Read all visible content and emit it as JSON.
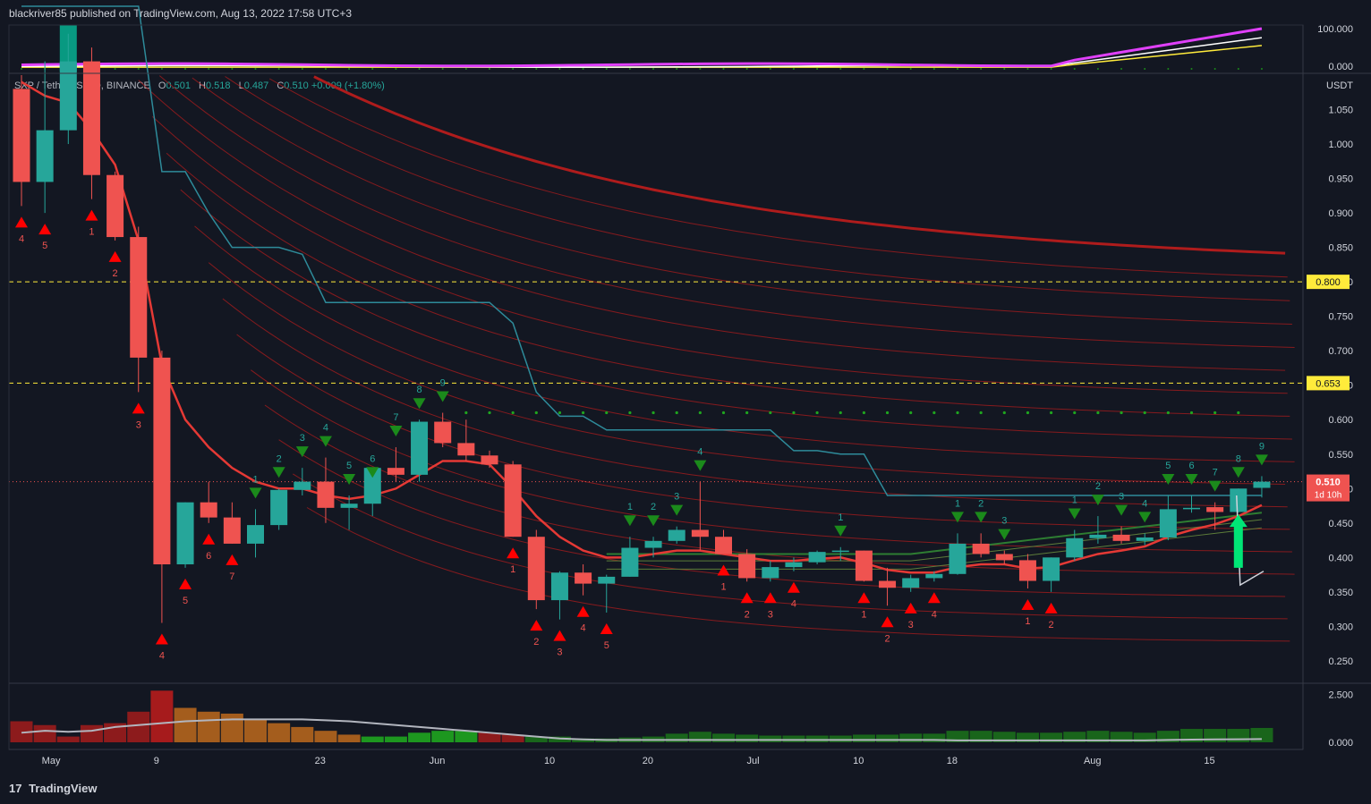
{
  "header": {
    "text": "blackriver85 published on TradingView.com, Aug 13, 2022 17:58 UTC+3"
  },
  "footer": {
    "brand": "TradingView",
    "logo_text": "17"
  },
  "symbol": {
    "name": "SXP / TetherUS, 2D, BINANCE",
    "o_label": "O",
    "o": "0.501",
    "h_label": "H",
    "h": "0.518",
    "l_label": "L",
    "l": "0.487",
    "c_label": "C",
    "c": "0.510",
    "change": "+0.009 (+1.80%)"
  },
  "price_axis": {
    "currency": "USDT",
    "ticks": [
      "1.050",
      "1.000",
      "0.950",
      "0.900",
      "0.850",
      "0.800",
      "0.750",
      "0.700",
      "0.650",
      "0.600",
      "0.550",
      "0.500",
      "0.450",
      "0.400",
      "0.350",
      "0.300",
      "0.250"
    ],
    "tick_values": [
      1.05,
      1.0,
      0.95,
      0.9,
      0.85,
      0.8,
      0.75,
      0.7,
      0.65,
      0.6,
      0.55,
      0.5,
      0.45,
      0.4,
      0.35,
      0.3,
      0.25
    ],
    "current_price_label": "0.510",
    "current_price": 0.51,
    "countdown": "1d 10h",
    "levels": [
      {
        "label": "0.800",
        "value": 0.8
      },
      {
        "label": "0.653",
        "value": 0.653
      }
    ]
  },
  "oscillator_axis": {
    "ticks": [
      "100.000",
      "0.000"
    ]
  },
  "volume_axis": {
    "ticks": [
      "2.500",
      "0.000"
    ]
  },
  "time_axis": {
    "labels": [
      "May",
      "9",
      "23",
      "Jun",
      "10",
      "20",
      "Jul",
      "10",
      "18",
      "Aug",
      "15"
    ],
    "positions": [
      2.5,
      7,
      14,
      19,
      23.8,
      28,
      32.5,
      37,
      41,
      47,
      52
    ]
  },
  "colors": {
    "bg": "#131722",
    "up": "#26a69a",
    "down": "#ef5350",
    "ema": "#e53935",
    "baseline": "#2e8b9a",
    "level": "#ffeb3b",
    "green_line": "#2e7d32",
    "signal_up": "#ff0000",
    "signal_down": "#1b8a1b"
  },
  "chart_data": {
    "type": "candlestick",
    "timeframe": "2D",
    "candles": [
      {
        "o": 1.08,
        "h": 1.1,
        "l": 0.91,
        "c": 0.945
      },
      {
        "o": 0.945,
        "h": 1.12,
        "l": 0.9,
        "c": 1.02
      },
      {
        "o": 1.02,
        "h": 1.16,
        "l": 1.0,
        "c": 1.12
      },
      {
        "o": 1.12,
        "h": 1.14,
        "l": 0.92,
        "c": 0.955
      },
      {
        "o": 0.955,
        "h": 0.96,
        "l": 0.86,
        "c": 0.865
      },
      {
        "o": 0.865,
        "h": 0.88,
        "l": 0.64,
        "c": 0.69
      },
      {
        "o": 0.69,
        "h": 0.7,
        "l": 0.305,
        "c": 0.39
      },
      {
        "o": 0.39,
        "h": 0.48,
        "l": 0.385,
        "c": 0.48
      },
      {
        "o": 0.48,
        "h": 0.51,
        "l": 0.45,
        "c": 0.458
      },
      {
        "o": 0.458,
        "h": 0.48,
        "l": 0.42,
        "c": 0.42
      },
      {
        "o": 0.42,
        "h": 0.47,
        "l": 0.4,
        "c": 0.447
      },
      {
        "o": 0.447,
        "h": 0.5,
        "l": 0.44,
        "c": 0.498
      },
      {
        "o": 0.498,
        "h": 0.53,
        "l": 0.49,
        "c": 0.51
      },
      {
        "o": 0.51,
        "h": 0.545,
        "l": 0.45,
        "c": 0.472
      },
      {
        "o": 0.472,
        "h": 0.49,
        "l": 0.44,
        "c": 0.478
      },
      {
        "o": 0.478,
        "h": 0.5,
        "l": 0.46,
        "c": 0.53
      },
      {
        "o": 0.53,
        "h": 0.56,
        "l": 0.51,
        "c": 0.52
      },
      {
        "o": 0.52,
        "h": 0.6,
        "l": 0.51,
        "c": 0.597
      },
      {
        "o": 0.597,
        "h": 0.61,
        "l": 0.56,
        "c": 0.566
      },
      {
        "o": 0.566,
        "h": 0.6,
        "l": 0.54,
        "c": 0.548
      },
      {
        "o": 0.548,
        "h": 0.555,
        "l": 0.53,
        "c": 0.535
      },
      {
        "o": 0.535,
        "h": 0.54,
        "l": 0.43,
        "c": 0.43
      },
      {
        "o": 0.43,
        "h": 0.44,
        "l": 0.325,
        "c": 0.338
      },
      {
        "o": 0.338,
        "h": 0.38,
        "l": 0.31,
        "c": 0.378
      },
      {
        "o": 0.378,
        "h": 0.39,
        "l": 0.345,
        "c": 0.362
      },
      {
        "o": 0.362,
        "h": 0.375,
        "l": 0.32,
        "c": 0.372
      },
      {
        "o": 0.372,
        "h": 0.43,
        "l": 0.372,
        "c": 0.414
      },
      {
        "o": 0.414,
        "h": 0.43,
        "l": 0.4,
        "c": 0.424
      },
      {
        "o": 0.424,
        "h": 0.445,
        "l": 0.42,
        "c": 0.44
      },
      {
        "o": 0.44,
        "h": 0.51,
        "l": 0.41,
        "c": 0.43
      },
      {
        "o": 0.43,
        "h": 0.44,
        "l": 0.405,
        "c": 0.405
      },
      {
        "o": 0.405,
        "h": 0.412,
        "l": 0.365,
        "c": 0.37
      },
      {
        "o": 0.37,
        "h": 0.395,
        "l": 0.365,
        "c": 0.386
      },
      {
        "o": 0.386,
        "h": 0.4,
        "l": 0.38,
        "c": 0.393
      },
      {
        "o": 0.393,
        "h": 0.41,
        "l": 0.39,
        "c": 0.408
      },
      {
        "o": 0.408,
        "h": 0.415,
        "l": 0.395,
        "c": 0.41
      },
      {
        "o": 0.41,
        "h": 0.41,
        "l": 0.365,
        "c": 0.366
      },
      {
        "o": 0.366,
        "h": 0.385,
        "l": 0.33,
        "c": 0.356
      },
      {
        "o": 0.356,
        "h": 0.375,
        "l": 0.35,
        "c": 0.37
      },
      {
        "o": 0.37,
        "h": 0.38,
        "l": 0.365,
        "c": 0.376
      },
      {
        "o": 0.376,
        "h": 0.435,
        "l": 0.375,
        "c": 0.42
      },
      {
        "o": 0.42,
        "h": 0.435,
        "l": 0.4,
        "c": 0.405
      },
      {
        "o": 0.405,
        "h": 0.41,
        "l": 0.39,
        "c": 0.396
      },
      {
        "o": 0.396,
        "h": 0.405,
        "l": 0.355,
        "c": 0.366
      },
      {
        "o": 0.366,
        "h": 0.4,
        "l": 0.35,
        "c": 0.4
      },
      {
        "o": 0.4,
        "h": 0.44,
        "l": 0.395,
        "c": 0.428
      },
      {
        "o": 0.428,
        "h": 0.46,
        "l": 0.42,
        "c": 0.433
      },
      {
        "o": 0.433,
        "h": 0.445,
        "l": 0.42,
        "c": 0.424
      },
      {
        "o": 0.424,
        "h": 0.435,
        "l": 0.418,
        "c": 0.429
      },
      {
        "o": 0.429,
        "h": 0.49,
        "l": 0.425,
        "c": 0.47
      },
      {
        "o": 0.47,
        "h": 0.49,
        "l": 0.465,
        "c": 0.472
      },
      {
        "o": 0.473,
        "h": 0.48,
        "l": 0.44,
        "c": 0.466
      },
      {
        "o": 0.466,
        "h": 0.5,
        "l": 0.465,
        "c": 0.5
      },
      {
        "o": 0.501,
        "h": 0.518,
        "l": 0.487,
        "c": 0.51
      }
    ],
    "ema_line": [
      1.09,
      1.07,
      1.06,
      1.02,
      0.97,
      0.86,
      0.68,
      0.6,
      0.56,
      0.53,
      0.51,
      0.5,
      0.5,
      0.49,
      0.485,
      0.49,
      0.5,
      0.52,
      0.54,
      0.54,
      0.535,
      0.5,
      0.46,
      0.43,
      0.41,
      0.4,
      0.4,
      0.405,
      0.41,
      0.41,
      0.405,
      0.4,
      0.395,
      0.395,
      0.398,
      0.4,
      0.392,
      0.382,
      0.378,
      0.378,
      0.386,
      0.39,
      0.39,
      0.384,
      0.386,
      0.396,
      0.405,
      0.41,
      0.416,
      0.43,
      0.44,
      0.448,
      0.46,
      0.476
    ],
    "baseline": [
      1.2,
      1.2,
      1.2,
      1.2,
      1.2,
      1.2,
      0.96,
      0.96,
      0.9,
      0.85,
      0.85,
      0.85,
      0.84,
      0.77,
      0.77,
      0.77,
      0.77,
      0.77,
      0.77,
      0.77,
      0.77,
      0.74,
      0.64,
      0.605,
      0.605,
      0.585,
      0.585,
      0.585,
      0.585,
      0.585,
      0.585,
      0.585,
      0.585,
      0.555,
      0.555,
      0.55,
      0.55,
      0.49,
      0.49,
      0.49,
      0.49,
      0.49,
      0.49,
      0.49,
      0.49,
      0.49,
      0.49,
      0.49,
      0.49,
      0.49,
      0.49,
      0.49,
      0.49,
      0.49
    ],
    "price_levels": [
      0.8,
      0.653
    ],
    "sequential_signals": [
      {
        "i": 0,
        "type": "sell",
        "n": "4"
      },
      {
        "i": 1,
        "type": "sell",
        "n": "5"
      },
      {
        "i": 3,
        "type": "sell",
        "n": "1"
      },
      {
        "i": 4,
        "type": "sell",
        "n": "2"
      },
      {
        "i": 5,
        "type": "sell",
        "n": "3"
      },
      {
        "i": 6,
        "type": "sell",
        "n": "4"
      },
      {
        "i": 7,
        "type": "sell",
        "n": "5"
      },
      {
        "i": 8,
        "type": "sell",
        "n": "6"
      },
      {
        "i": 9,
        "type": "sell",
        "n": "7"
      },
      {
        "i": 10,
        "type": "buy",
        "n": "1"
      },
      {
        "i": 11,
        "type": "buy",
        "n": "2"
      },
      {
        "i": 12,
        "type": "buy",
        "n": "3"
      },
      {
        "i": 13,
        "type": "buy",
        "n": "4"
      },
      {
        "i": 14,
        "type": "buy",
        "n": "5"
      },
      {
        "i": 15,
        "type": "buy",
        "n": "6"
      },
      {
        "i": 16,
        "type": "buy",
        "n": "7"
      },
      {
        "i": 17,
        "type": "buy",
        "n": "8"
      },
      {
        "i": 18,
        "type": "buy",
        "n": "9"
      },
      {
        "i": 21,
        "type": "sell",
        "n": "1"
      },
      {
        "i": 22,
        "type": "sell",
        "n": "2"
      },
      {
        "i": 23,
        "type": "sell",
        "n": "3"
      },
      {
        "i": 24,
        "type": "sell",
        "n": "4"
      },
      {
        "i": 25,
        "type": "sell",
        "n": "5"
      },
      {
        "i": 26,
        "type": "buy",
        "n": "1"
      },
      {
        "i": 27,
        "type": "buy",
        "n": "2"
      },
      {
        "i": 28,
        "type": "buy",
        "n": "3"
      },
      {
        "i": 29,
        "type": "buy",
        "n": "4"
      },
      {
        "i": 30,
        "type": "sell",
        "n": "1"
      },
      {
        "i": 31,
        "type": "sell",
        "n": "2"
      },
      {
        "i": 32,
        "type": "sell",
        "n": "3"
      },
      {
        "i": 33,
        "type": "sell",
        "n": "4"
      },
      {
        "i": 35,
        "type": "buy",
        "n": "1"
      },
      {
        "i": 36,
        "type": "sell",
        "n": "1"
      },
      {
        "i": 37,
        "type": "sell",
        "n": "2"
      },
      {
        "i": 38,
        "type": "sell",
        "n": "3"
      },
      {
        "i": 39,
        "type": "sell",
        "n": "4"
      },
      {
        "i": 40,
        "type": "buy",
        "n": "1"
      },
      {
        "i": 41,
        "type": "buy",
        "n": "2"
      },
      {
        "i": 42,
        "type": "buy",
        "n": "3"
      },
      {
        "i": 43,
        "type": "sell",
        "n": "1"
      },
      {
        "i": 44,
        "type": "sell",
        "n": "2"
      },
      {
        "i": 45,
        "type": "buy",
        "n": "1"
      },
      {
        "i": 46,
        "type": "buy",
        "n": "2"
      },
      {
        "i": 47,
        "type": "buy",
        "n": "3"
      },
      {
        "i": 48,
        "type": "buy",
        "n": "4"
      },
      {
        "i": 49,
        "type": "buy",
        "n": "5"
      },
      {
        "i": 50,
        "type": "buy",
        "n": "6"
      },
      {
        "i": 51,
        "type": "buy",
        "n": "7"
      },
      {
        "i": 52,
        "type": "buy",
        "n": "8"
      },
      {
        "i": 53,
        "type": "buy",
        "n": "9"
      }
    ],
    "volume": [
      1.1,
      0.9,
      0.3,
      0.9,
      1.0,
      1.6,
      2.7,
      1.8,
      1.6,
      1.5,
      1.2,
      1.0,
      0.8,
      0.6,
      0.4,
      0.3,
      0.3,
      0.5,
      0.6,
      0.6,
      0.5,
      0.4,
      0.3,
      0.3,
      0.2,
      0.2,
      0.25,
      0.3,
      0.45,
      0.55,
      0.45,
      0.4,
      0.35,
      0.35,
      0.35,
      0.35,
      0.4,
      0.4,
      0.45,
      0.45,
      0.6,
      0.6,
      0.55,
      0.5,
      0.5,
      0.55,
      0.6,
      0.55,
      0.5,
      0.6,
      0.7,
      0.7,
      0.7,
      0.75
    ],
    "volume_ma": [
      0.5,
      0.6,
      0.55,
      0.6,
      0.8,
      0.9,
      1.0,
      1.1,
      1.15,
      1.2,
      1.2,
      1.2,
      1.2,
      1.15,
      1.1,
      1.0,
      0.9,
      0.8,
      0.7,
      0.6,
      0.5,
      0.4,
      0.3,
      0.2,
      0.15,
      0.12,
      0.12,
      0.12,
      0.12,
      0.12,
      0.12,
      0.12,
      0.12,
      0.12,
      0.12,
      0.12,
      0.12,
      0.12,
      0.12,
      0.12,
      0.1,
      0.1,
      0.1,
      0.1,
      0.1,
      0.1,
      0.1,
      0.1,
      0.1,
      0.12,
      0.14,
      0.15,
      0.16,
      0.17
    ]
  }
}
